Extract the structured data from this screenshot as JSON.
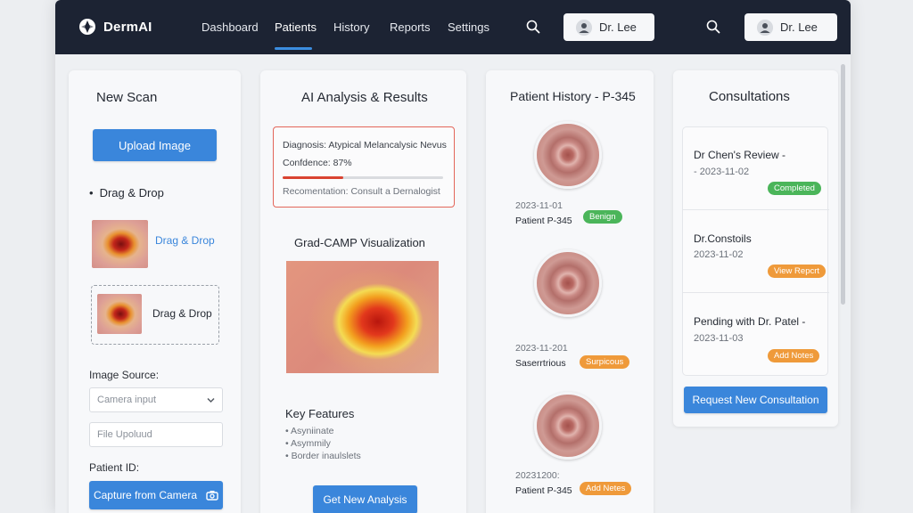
{
  "app": {
    "name": "DermAI"
  },
  "nav": {
    "links": [
      "Dashboard",
      "Patients",
      "History",
      "Reports",
      "Settings"
    ],
    "active": "Patients",
    "user_label": "Dr. Lee",
    "user_label_2": "Dr. Lee"
  },
  "new_scan": {
    "title": "New Scan",
    "upload_button": "Upload Image",
    "drag_drop_heading": "Drag & Drop",
    "drag_drop_link": "Drag & Drop",
    "drop_zone_label": "Drag & Drop",
    "image_source_label": "Image Source:",
    "image_source_value": "Camera input",
    "file_upload_placeholder": "File Upoluud",
    "patient_id_label": "Patient ID:",
    "capture_button": "Capture from Camera"
  },
  "analysis": {
    "title": "AI Analysis & Results",
    "diagnosis": "Diagnosis: Atypical Melancalysic Nevus",
    "confidence_text": "Confdence: 87%",
    "confidence_value": 0.87,
    "recommendation": "Recomentation: Consult a Dernalogist",
    "gradcam_title": "Grad-CAMP Visualization",
    "key_features_title": "Key Features",
    "key_features": [
      "Asyniinate",
      "Asymmily",
      "Border inaulslets"
    ],
    "get_analysis_button": "Get New Analysis"
  },
  "history": {
    "title": "Patient History - P-345",
    "entries": [
      {
        "date": "2023-11-01",
        "name": "Patient P-345",
        "badge": "Benign",
        "badge_color": "#4bb55a"
      },
      {
        "date": "2023-11-201",
        "name": "Saserrtrious",
        "badge": "Surpicous",
        "badge_color": "#ef9a3a"
      },
      {
        "date": "20231200:",
        "name": "Patient P-345",
        "badge": "Add Netes",
        "badge_color": "#ef9a3a"
      }
    ]
  },
  "consultations": {
    "title": "Consultations",
    "items": [
      {
        "title": "Dr Chen's Review -",
        "date": "- 2023-11-02",
        "badge": "Completed",
        "badge_color": "#4bb55a"
      },
      {
        "title": "Dr.Constoils",
        "date": "2023-11-02",
        "badge": "View Repcrt",
        "badge_color": "#ef9a3a"
      },
      {
        "title": "Pending with Dr. Patel -",
        "date": "2023-11-03",
        "badge": "Add Notes",
        "badge_color": "#ef9a3a"
      }
    ],
    "request_button": "Request New Consultation"
  },
  "colors": {
    "navbar": "#1c2333",
    "primary": "#3a86db",
    "accent_red": "#e3665a",
    "success": "#4bb55a",
    "warning": "#ef9a3a"
  },
  "icons": [
    "logo-icon",
    "search-icon",
    "user-icon",
    "chevron-down-icon",
    "camera-icon"
  ]
}
